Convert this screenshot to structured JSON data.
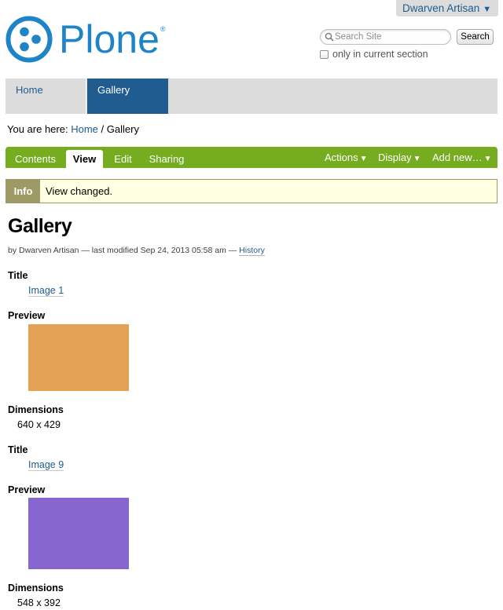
{
  "user_menu": {
    "name": "Dwarven Artisan",
    "arrow": "▼"
  },
  "logo": {
    "text": "Plone",
    "registered": "®"
  },
  "search": {
    "placeholder": "Search Site",
    "button_label": "Search",
    "current_section_label": "only in current section"
  },
  "global_nav": [
    {
      "label": "Home"
    },
    {
      "label": "Gallery"
    }
  ],
  "breadcrumbs": {
    "prefix": "You are here:",
    "home": "Home",
    "separator": "/",
    "current": "Gallery"
  },
  "content_tabs": [
    {
      "label": "Contents"
    },
    {
      "label": "View"
    },
    {
      "label": "Edit"
    },
    {
      "label": "Sharing"
    }
  ],
  "content_menus": [
    {
      "label": "Actions",
      "arrow": "▼"
    },
    {
      "label": "Display",
      "arrow": "▼"
    },
    {
      "label": "Add new…",
      "arrow": "▼"
    }
  ],
  "message": {
    "type": "Info",
    "text": "View changed."
  },
  "page": {
    "title": "Gallery",
    "byline_prefix": "by Dwarven Artisan — last modified Sep 24, 2013 05:58 am —",
    "history_link": "History"
  },
  "images": [
    {
      "title_label": "Title",
      "title": "Image 1",
      "preview_label": "Preview",
      "preview_color": "#e4a257",
      "dimensions_label": "Dimensions",
      "dimensions": "640 x 429"
    },
    {
      "title_label": "Title",
      "title": "Image 9",
      "preview_label": "Preview",
      "preview_color": "#8866d0",
      "dimensions_label": "Dimensions",
      "dimensions": "548 x 392"
    }
  ],
  "colors": {
    "brand_blue": "#1e84c6",
    "nav_active": "#205c90",
    "link": "#205c90",
    "content_bar": "#76ac1f",
    "info_label_bg": "#9d9a66",
    "info_bg": "#ffffe1"
  },
  "icons": {
    "logo": "plone-logo-icon",
    "search": "magnifier-icon"
  }
}
